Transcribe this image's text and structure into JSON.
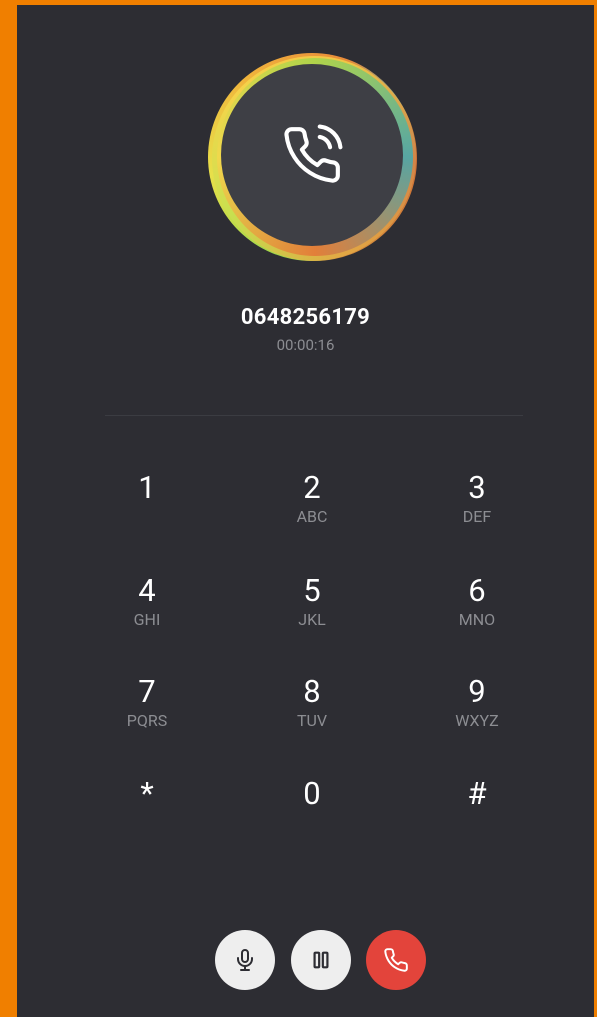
{
  "call": {
    "number": "0648256179",
    "duration": "00:00:16"
  },
  "avatar": {
    "icon": "phone-calling-icon"
  },
  "keypad": {
    "keys": [
      {
        "digit": "1",
        "letters": ""
      },
      {
        "digit": "2",
        "letters": "ABC"
      },
      {
        "digit": "3",
        "letters": "DEF"
      },
      {
        "digit": "4",
        "letters": "GHI"
      },
      {
        "digit": "5",
        "letters": "JKL"
      },
      {
        "digit": "6",
        "letters": "MNO"
      },
      {
        "digit": "7",
        "letters": "PQRS"
      },
      {
        "digit": "8",
        "letters": "TUV"
      },
      {
        "digit": "9",
        "letters": "WXYZ"
      },
      {
        "digit": "*",
        "letters": ""
      },
      {
        "digit": "0",
        "letters": ""
      },
      {
        "digit": "#",
        "letters": ""
      }
    ]
  },
  "controls": [
    {
      "name": "mute",
      "icon": "microphone-icon"
    },
    {
      "name": "hold",
      "icon": "pause-icon"
    },
    {
      "name": "hangup",
      "icon": "phone-hangup-icon"
    }
  ],
  "colors": {
    "outer_frame": "#f07f00",
    "background": "#2d2d33",
    "avatar_fill": "#3e3f45",
    "secondary_text": "#8c8d92",
    "hangup_red": "#e3443b",
    "control_light": "#eeeeee"
  }
}
